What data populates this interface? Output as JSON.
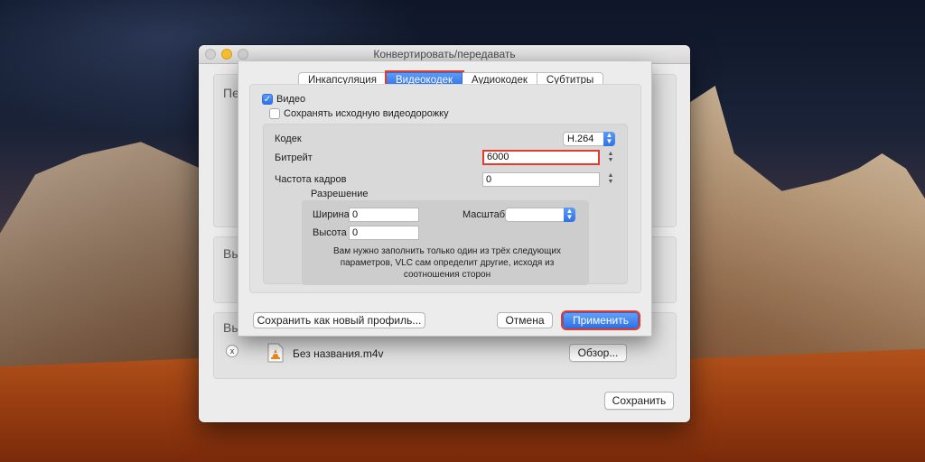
{
  "window": {
    "title": "Конвертировать/передавать",
    "bg_group_labels": [
      "Пе",
      "Вы",
      "Вы"
    ],
    "file_name": "Без названия.m4v",
    "browse_label": "Обзор...",
    "save_label": "Сохранить",
    "remove_label": "x"
  },
  "sheet": {
    "tabs": [
      {
        "label": "Инкапсуляция",
        "active": false
      },
      {
        "label": "Видеокодек",
        "active": true
      },
      {
        "label": "Аудиокодек",
        "active": false
      },
      {
        "label": "Субтитры",
        "active": false
      }
    ],
    "video_checkbox": {
      "label": "Видео",
      "checked": true
    },
    "keep_original_checkbox": {
      "label": "Сохранять исходную видеодорожку",
      "checked": false
    },
    "codec": {
      "label": "Кодек",
      "value": "H.264"
    },
    "bitrate": {
      "label": "Битрейт",
      "value": "6000"
    },
    "framerate": {
      "label": "Частота кадров",
      "value": "0"
    },
    "resolution": {
      "title": "Разрешение",
      "width_label": "Ширина",
      "width_value": "0",
      "height_label": "Высота",
      "height_value": "0",
      "scale_label": "Масштаб",
      "scale_value": "",
      "note": "Вам нужно заполнить только один из трёх следующих параметров, VLC сам определит другие, исходя из соотношения сторон"
    },
    "save_profile_label": "Сохранить как новый профиль...",
    "cancel_label": "Отмена",
    "apply_label": "Применить"
  },
  "colors": {
    "accent": "#2f72e6",
    "highlight": "#e23b2e"
  }
}
